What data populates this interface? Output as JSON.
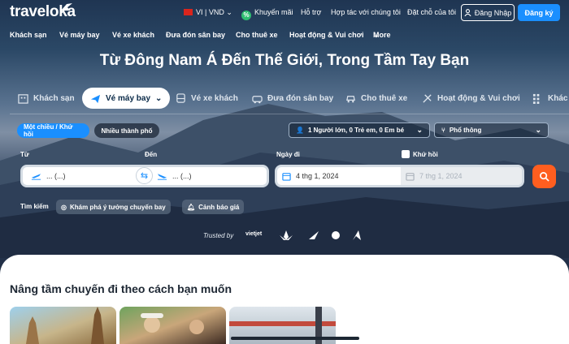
{
  "brand": {
    "name": "traveloka"
  },
  "topbar": {
    "locale": "VI | VND",
    "rewards": "Khuyến mãi",
    "support": "Hỗ trợ",
    "partner": "Hợp tác với chúng tôi",
    "bookings": "Đặt chỗ của tôi",
    "login": "Đăng Nhập",
    "register": "Đăng ký"
  },
  "nav": [
    "Khách sạn",
    "Vé máy bay",
    "Vé xe khách",
    "Đưa đón sân bay",
    "Cho thuê xe",
    "Hoạt động & Vui chơi",
    "More"
  ],
  "headline": "Từ Đông Nam Á Đến Thế Giới, Trong Tầm Tay Bạn",
  "tabs": [
    "Khách sạn",
    "Vé máy bay",
    "Vé xe khách",
    "Đưa đón sân bay",
    "Cho thuê xe",
    "Hoạt động & Vui chơi",
    "Khác"
  ],
  "trip_types": {
    "oneway": "Một chiều / Khứ hồi",
    "multi": "Nhiều thành phố"
  },
  "passengers": "1 Người lớn, 0 Trẻ em, 0 Em bé",
  "cabin": "Phổ thông",
  "form": {
    "from_label": "Từ",
    "to_label": "Đến",
    "from_value": "... (...)",
    "to_value": "... (...)",
    "depart_label": "Ngày đi",
    "depart_value": "4 thg 1, 2024",
    "return_label": "Khứ hồi",
    "return_value": "7 thg 1, 2024"
  },
  "search_row": {
    "label": "Tìm kiếm",
    "explore": "Khám phá ý tưởng chuyến bay",
    "alert": "Cảnh báo giá"
  },
  "trusted": {
    "label": "Trusted by",
    "vietjet": "vietjet"
  },
  "section": {
    "title": "Nâng tầm chuyến đi theo cách bạn muốn"
  },
  "colors": {
    "accent": "#1a8fff",
    "search": "#ff5e1f",
    "title": "#1d2733"
  }
}
